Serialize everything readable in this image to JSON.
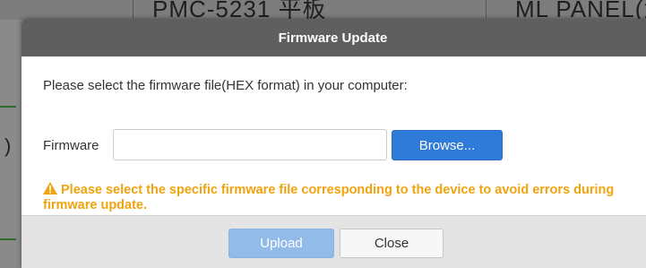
{
  "background": {
    "left_text": "PMC-5231  平板",
    "right_text": "ML PANEL(瀬口",
    "paren": ")"
  },
  "dialog": {
    "title": "Firmware Update",
    "instruction": "Please select the firmware file(HEX format) in your computer:",
    "firmware_label": "Firmware",
    "firmware_value": "",
    "firmware_placeholder": "",
    "browse_label": "Browse...",
    "warning_icon": "warning-triangle-icon",
    "warning_text": "Please select the specific firmware file corresponding to the device to avoid errors during firmware update.",
    "upload_label": "Upload",
    "upload_enabled": false,
    "close_label": "Close"
  },
  "colors": {
    "header_bg": "#5f5f5f",
    "primary": "#2f7bd9",
    "primary_disabled": "#92bbe9",
    "warning": "#f0a30f",
    "footer_bg": "#e4e4e4"
  }
}
